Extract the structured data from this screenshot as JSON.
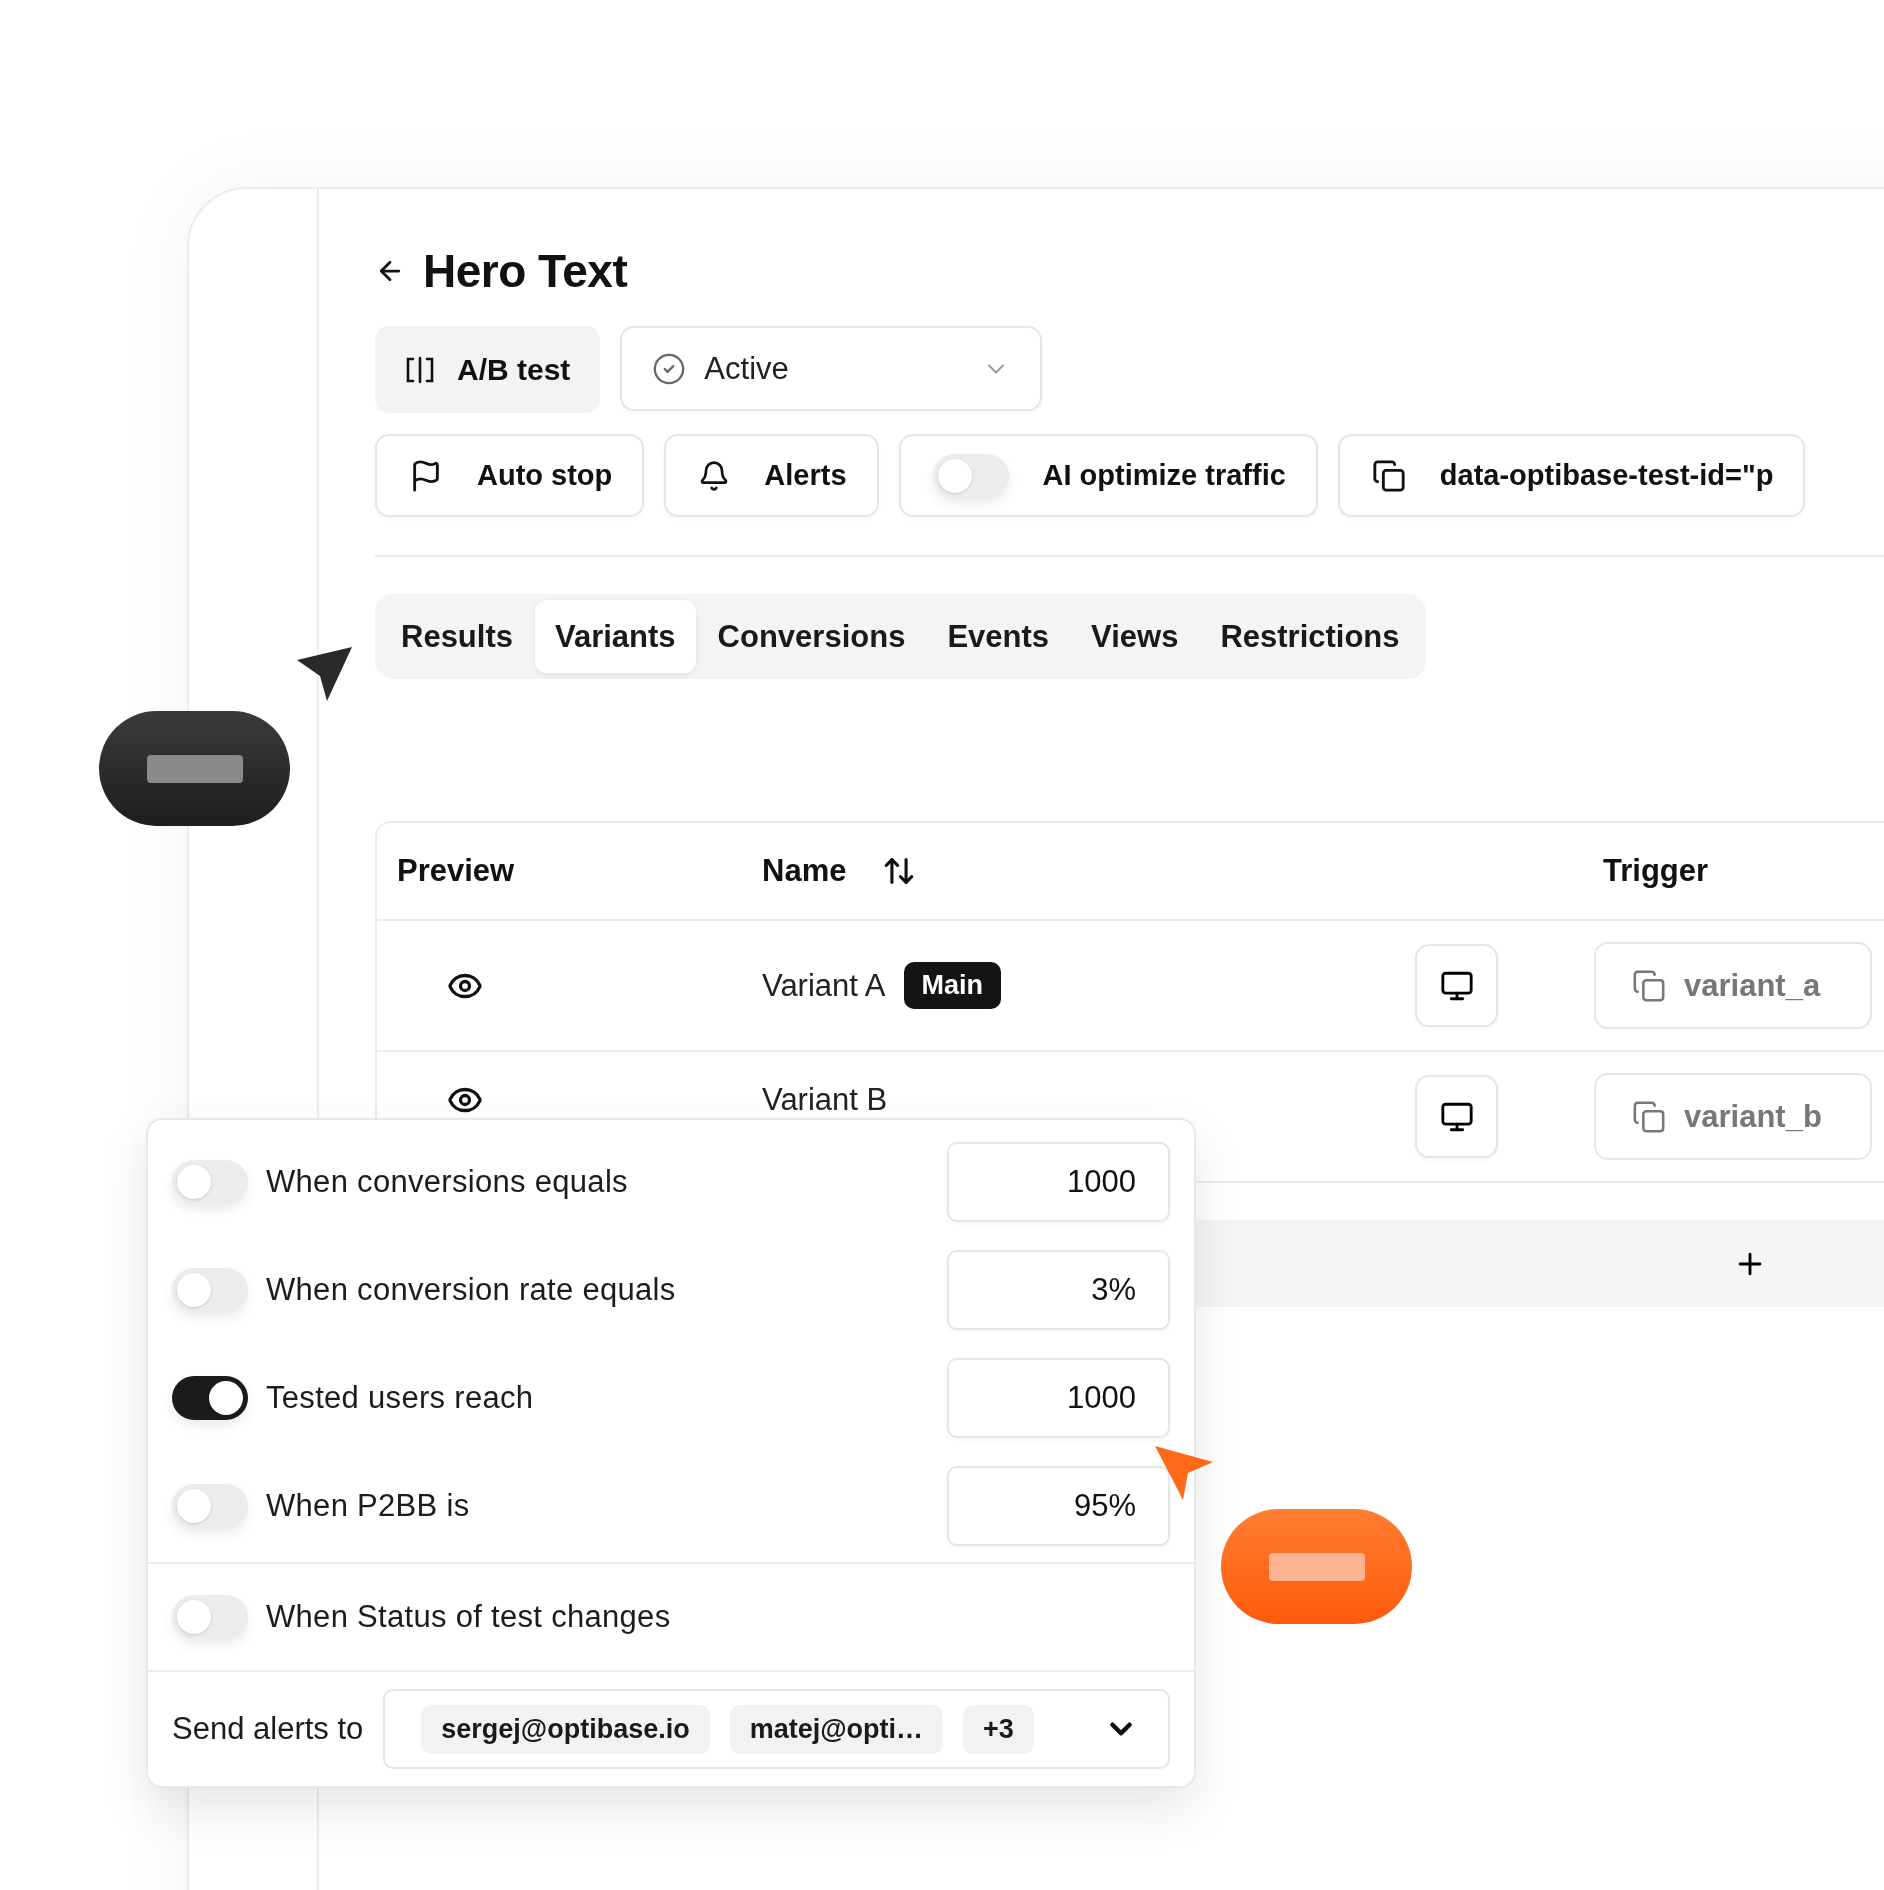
{
  "title": "Hero Text",
  "test_type": {
    "label": "A/B test"
  },
  "status": {
    "value": "Active"
  },
  "actions": [
    {
      "kind": "flag",
      "label": "Auto stop"
    },
    {
      "kind": "bell",
      "label": "Alerts"
    },
    {
      "kind": "toggle",
      "label": "AI optimize traffic",
      "on": false
    },
    {
      "kind": "copy",
      "label": "data-optibase-test-id=\"p"
    }
  ],
  "tabs": [
    {
      "label": "Results",
      "selected": false
    },
    {
      "label": "Variants",
      "selected": true
    },
    {
      "label": "Conversions",
      "selected": false
    },
    {
      "label": "Events",
      "selected": false
    },
    {
      "label": "Views",
      "selected": false
    },
    {
      "label": "Restrictions",
      "selected": false
    }
  ],
  "table": {
    "columns": [
      "Preview",
      "Name",
      "Trigger"
    ],
    "rows": [
      {
        "name": "Variant A",
        "badge": "Main",
        "trigger": "variant_a"
      },
      {
        "name": "Variant B",
        "trigger": "variant_b"
      }
    ]
  },
  "alert_settings": {
    "conditions": [
      {
        "label": "When conversions equals",
        "on": false,
        "value": "1000"
      },
      {
        "label": "When conversion rate equals",
        "on": false,
        "value": "3%"
      },
      {
        "label": "Tested users reach",
        "on": true,
        "value": "1000"
      },
      {
        "label": "When P2BB is",
        "on": false,
        "value": "95%"
      }
    ],
    "status_change": {
      "label": "When Status of test changes",
      "on": false
    },
    "send_to": {
      "label": "Send alerts to",
      "recipients": [
        "sergej@optibase.io",
        "matej@opti…"
      ],
      "more": "+3"
    }
  }
}
